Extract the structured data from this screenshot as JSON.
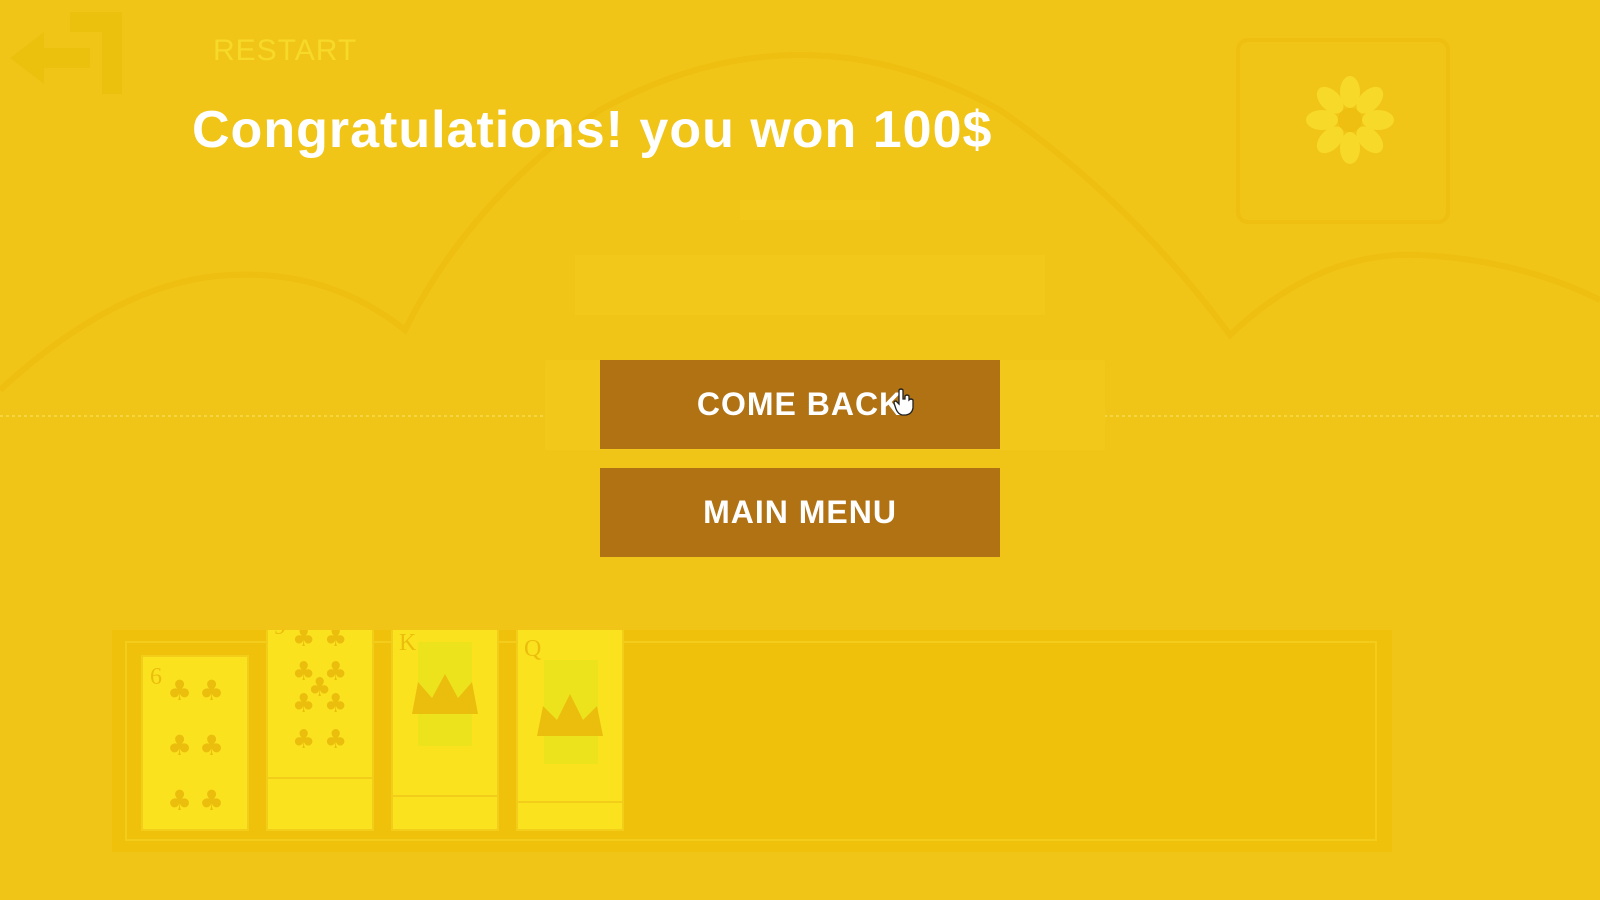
{
  "toolbar": {
    "restart_label": "RESTART",
    "back_icon": "back-arrow-icon",
    "settings_icon": "gear-icon"
  },
  "result": {
    "message": "Congratulations! you won 100$"
  },
  "menu": {
    "come_back_label": "COME BACK",
    "main_menu_label": "MAIN MENU"
  },
  "hand": {
    "cards": [
      {
        "rank": "6",
        "suit": "clubs"
      },
      {
        "rank": "9",
        "suit": "clubs"
      },
      {
        "rank": "K",
        "suit": "clubs"
      },
      {
        "rank": "Q",
        "suit": "clubs"
      }
    ]
  },
  "colors": {
    "background": "#f0c518",
    "button": "#b07213",
    "text": "#ffffff",
    "card_face": "#fbe21f"
  }
}
